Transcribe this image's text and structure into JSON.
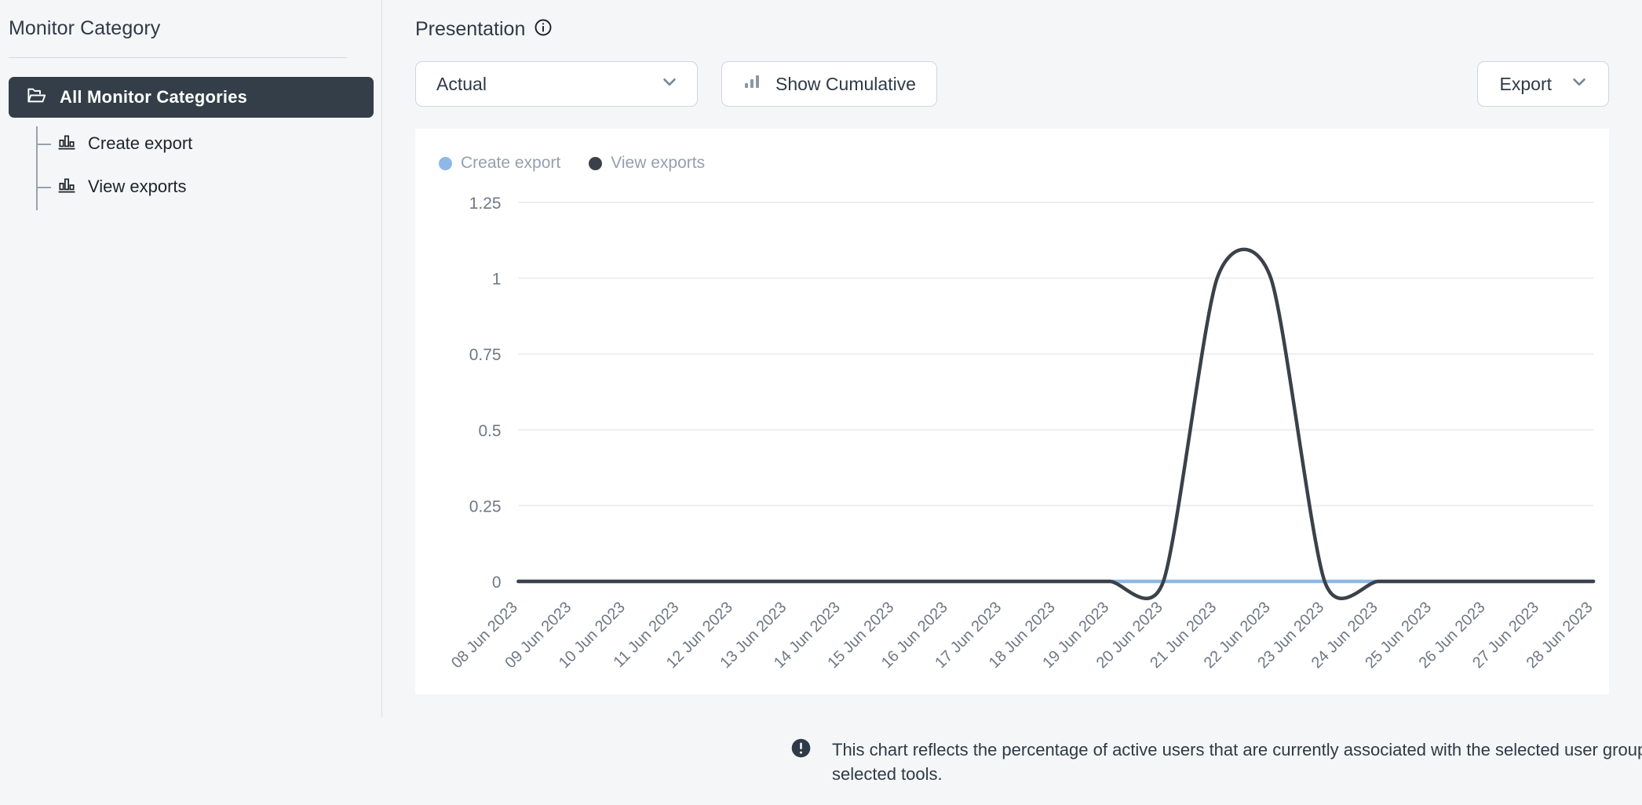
{
  "sidebar": {
    "title": "Monitor Category",
    "root": {
      "label": "All Monitor Categories",
      "icon": "folder-open-icon"
    },
    "items": [
      {
        "label": "Create export",
        "icon": "bar-chart-icon"
      },
      {
        "label": "View exports",
        "icon": "bar-chart-icon"
      }
    ]
  },
  "main": {
    "panel_title": "Presentation",
    "info_icon": "info-circle-icon",
    "toolbar": {
      "presentation_select": {
        "value": "Actual",
        "chevron": "chevron-down-icon"
      },
      "cumulative_button": {
        "label": "Show Cumulative",
        "icon": "bar-chart-icon"
      },
      "export_button": {
        "label": "Export",
        "chevron": "chevron-down-icon"
      }
    },
    "footnote": {
      "icon": "exclamation-circle-icon",
      "text": "This chart reflects the percentage of active users that are currently associated with the selected user groups and categories that have used the selected tools."
    }
  },
  "colors": {
    "accent_blue": "#8EB8E5",
    "dark_navy": "#333E48",
    "page_bg": "#F5F6F7",
    "card_bg": "#FFFFFF",
    "grid": "#EDEEF0",
    "muted_text": "#95A0AE"
  },
  "chart_data": {
    "type": "line",
    "title": "",
    "xlabel": "",
    "ylabel": "",
    "ylim": [
      0,
      1.25
    ],
    "yticks": [
      0,
      0.25,
      0.5,
      0.75,
      1,
      1.25
    ],
    "ytick_labels": [
      "0",
      "0.25",
      "0.5",
      "0.75",
      "1",
      "1.25"
    ],
    "grid": true,
    "legend_position": "top-left",
    "categories": [
      "08 Jun 2023",
      "09 Jun 2023",
      "10 Jun 2023",
      "11 Jun 2023",
      "12 Jun 2023",
      "13 Jun 2023",
      "14 Jun 2023",
      "15 Jun 2023",
      "16 Jun 2023",
      "17 Jun 2023",
      "18 Jun 2023",
      "19 Jun 2023",
      "20 Jun 2023",
      "21 Jun 2023",
      "22 Jun 2023",
      "23 Jun 2023",
      "24 Jun 2023",
      "25 Jun 2023",
      "26 Jun 2023",
      "27 Jun 2023",
      "28 Jun 2023"
    ],
    "series": [
      {
        "name": "Create export",
        "color": "#8EB8E5",
        "values": [
          0,
          0,
          0,
          0,
          0,
          0,
          0,
          0,
          0,
          0,
          0,
          0,
          0,
          0,
          0,
          0,
          0,
          0,
          0,
          0,
          0
        ]
      },
      {
        "name": "View exports",
        "color": "#3A4149",
        "values": [
          0,
          0,
          0,
          0,
          0,
          0,
          0,
          0,
          0,
          0,
          0,
          0,
          0,
          1,
          1,
          0,
          0,
          0,
          0,
          0,
          0
        ]
      }
    ]
  }
}
